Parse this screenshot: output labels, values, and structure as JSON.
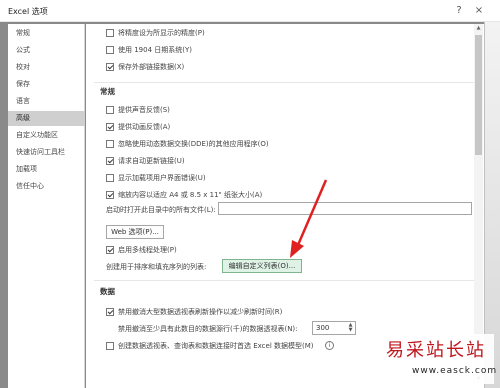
{
  "window": {
    "title": "Excel 选项",
    "help_label": "?",
    "close_label": "×"
  },
  "sidebar": {
    "items": [
      {
        "label": "常规"
      },
      {
        "label": "公式"
      },
      {
        "label": "校对"
      },
      {
        "label": "保存"
      },
      {
        "label": "语言"
      },
      {
        "label": "高级",
        "active": true
      },
      {
        "label": "自定义功能区"
      },
      {
        "label": "快速访问工具栏"
      },
      {
        "label": "加载项"
      },
      {
        "label": "信任中心"
      }
    ]
  },
  "content": {
    "top_options": [
      {
        "label": "将精度设为所显示的精度(P)",
        "checked": false
      },
      {
        "label": "使用 1904 日期系统(Y)",
        "checked": false
      },
      {
        "label": "保存外部链接数据(X)",
        "checked": true
      }
    ],
    "general": {
      "title": "常规",
      "options": [
        {
          "label": "提供声音反馈(S)",
          "checked": false
        },
        {
          "label": "提供动画反馈(A)",
          "checked": true
        },
        {
          "label": "忽略使用动态数据交换(DDE)的其他应用程序(O)",
          "checked": false
        },
        {
          "label": "请求自动更新链接(U)",
          "checked": true
        },
        {
          "label": "显示加载项用户界面错误(U)",
          "checked": false
        },
        {
          "label": "缩放内容以适应 A4 或 8.5 x 11\" 纸张大小(A)",
          "checked": true
        }
      ],
      "startup_label": "启动时打开此目录中的所有文件(L):",
      "startup_value": "",
      "web_options_label": "Web 选项(P)...",
      "multithread_label": "启用多线程处理(P)",
      "multithread_checked": true,
      "custom_list_label": "创建用于排序和填充序列的列表:",
      "edit_custom_lists_label": "编辑自定义列表(O)..."
    },
    "data": {
      "title": "数据",
      "undo_large_label": "禁用撤消大型数据透视表刷新操作以减少刷新时间(R)",
      "undo_large_checked": true,
      "undo_rows_label": "禁用撤消至少具有此数目的数据源行(千)的数据透视表(N):",
      "undo_rows_value": "300",
      "data_model_label": "创建数据透视表、查询表和数据连接时首选 Excel 数据模型(M)",
      "data_model_checked": false,
      "info_icon": "info-icon"
    }
  },
  "annotation": {
    "arrow_color": "#e02020"
  },
  "watermark": {
    "main": "易采站长站",
    "sub": "www.easck.com"
  }
}
